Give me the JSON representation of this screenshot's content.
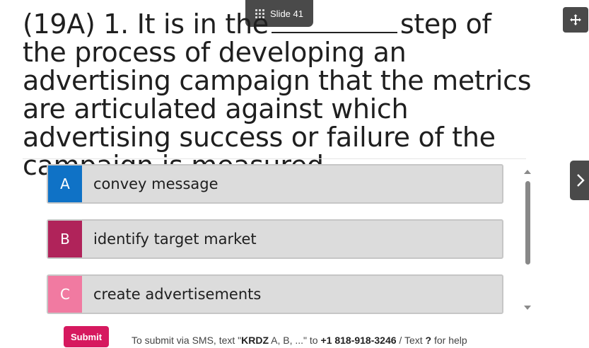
{
  "slide": {
    "label": "Slide 41"
  },
  "question": {
    "before_blank": "(19A) 1. It is in the",
    "after_blank": "step of the process of developing an advertising campaign that the metrics are articulated against which advertising success or failure of the campaign is measured."
  },
  "options": [
    {
      "letter": "A",
      "text": "convey message",
      "color": "#0f72c6"
    },
    {
      "letter": "B",
      "text": "identify target market",
      "color": "#b0235a"
    },
    {
      "letter": "C",
      "text": "create advertisements",
      "color": "#f17aa1"
    }
  ],
  "footer": {
    "submit_label": "Submit",
    "sms_prefix": "To submit via SMS, text \"",
    "sms_code": "KRDZ",
    "sms_mid": " A, B, ...\" to ",
    "sms_number": "+1 818-918-3246",
    "sms_sep": " / Text ",
    "sms_q": "?",
    "sms_suffix": " for help"
  },
  "icons": {
    "slide_icon": "grid-icon",
    "move_icon": "move-icon",
    "next_icon": "chevron-right-icon"
  }
}
